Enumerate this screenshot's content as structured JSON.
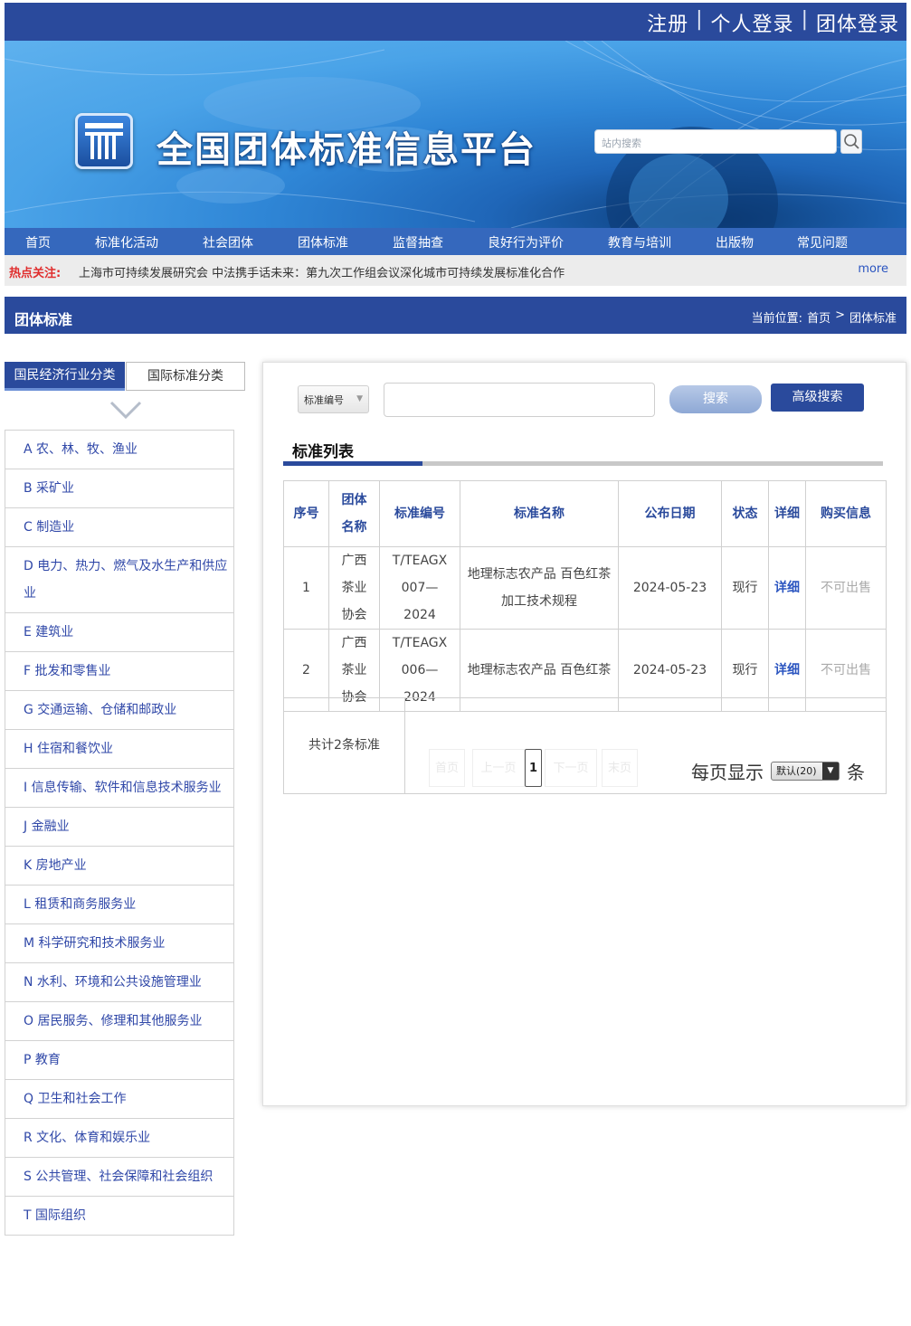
{
  "header": {
    "register": "注册",
    "personal_login": "个人登录",
    "group_login": "团体登录",
    "separator": "|"
  },
  "banner": {
    "site_title": "全国团体标准信息平台",
    "search_placeholder": "站内搜索",
    "search_icon": "search-icon"
  },
  "nav": [
    "首页",
    "标准化活动",
    "社会团体",
    "团体标准",
    "监督抽查",
    "良好行为评价",
    "教育与培训",
    "出版物",
    "常见问题"
  ],
  "hot": {
    "label": "热点关注:",
    "text": "上海市可持续发展研究会 中法携手话未来：第九次工作组会议深化城市可持续发展标准化合作",
    "more": "more"
  },
  "title_bar": {
    "title": "团体标准",
    "location_label": "当前位置:",
    "home": "首页",
    "arrow": ">",
    "current": "团体标准"
  },
  "sidebar": {
    "tab_active": "国民经济行业分类",
    "tab_inactive": "国际标准分类",
    "items": [
      "A 农、林、牧、渔业",
      "B 采矿业",
      "C 制造业",
      "D 电力、热力、燃气及水生产和供应业",
      "E 建筑业",
      "F 批发和零售业",
      "G 交通运输、仓储和邮政业",
      "H 住宿和餐饮业",
      "I 信息传输、软件和信息技术服务业",
      "J 金融业",
      "K 房地产业",
      "L 租赁和商务服务业",
      "M 科学研究和技术服务业",
      "N 水利、环境和公共设施管理业",
      "O 居民服务、修理和其他服务业",
      "P 教育",
      "Q 卫生和社会工作",
      "R 文化、体育和娱乐业",
      "S 公共管理、社会保障和社会组织",
      "T 国际组织"
    ]
  },
  "search": {
    "select_value": "标准编号",
    "keyword_value": "",
    "search_button": "搜索",
    "advanced_button": "高级搜索"
  },
  "list": {
    "title": "标准列表",
    "headers": [
      "序号",
      "团体名称",
      "标准编号",
      "标准名称",
      "公布日期",
      "状态",
      "详细",
      "购买信息"
    ],
    "rows": [
      {
        "no": "1",
        "org": "广西茶业协会",
        "code": "T/TEAGX 007—2024",
        "name": "地理标志农产品 百色红茶 加工技术规程",
        "date": "2024-05-23",
        "status": "现行",
        "detail": "详细",
        "buy": "不可出售"
      },
      {
        "no": "2",
        "org": "广西茶业协会",
        "code": "T/TEAGX 006—2024",
        "name": "地理标志农产品 百色红茶",
        "date": "2024-05-23",
        "status": "现行",
        "detail": "详细",
        "buy": "不可出售"
      }
    ]
  },
  "pager": {
    "total": "共计2条标准",
    "first": "首页",
    "prev": "上一页",
    "current": "1",
    "next": "下一页",
    "last": "末页",
    "per_page_label": "每页显示",
    "per_page_value": "默认(20)",
    "per_page_unit": "条"
  },
  "colors": {
    "primary": "#2a4a9c",
    "nav": "#3568bd",
    "link": "#3048a8",
    "hot_label": "#e02d2d"
  }
}
